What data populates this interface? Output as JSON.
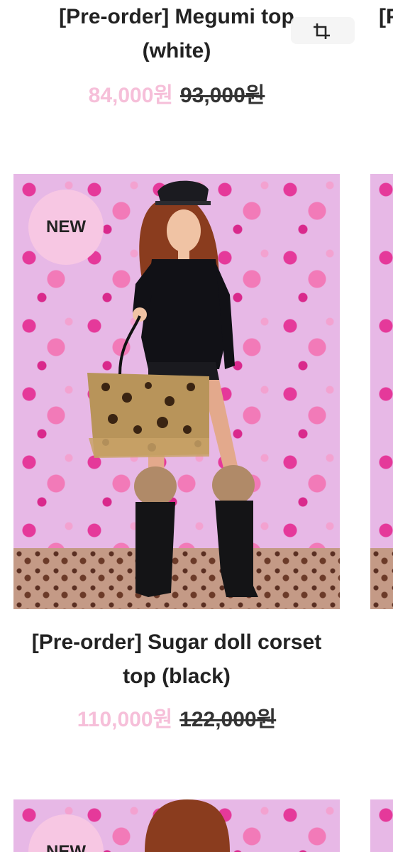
{
  "products": [
    {
      "title_line1": "[Pre-order] Megumi top",
      "title_line2": "(white)",
      "sale_price": "84,000원",
      "original_price": "93,000원"
    },
    {
      "badge": "NEW",
      "title_line1": "[Pre-order] Sugar doll corset",
      "title_line2": "top (black)",
      "sale_price": "110,000원",
      "original_price": "122,000원"
    },
    {
      "badge": "NEW"
    }
  ],
  "next_column": {
    "title_fragment": "[P"
  },
  "overlay": {
    "icon": "crop-icon"
  },
  "colors": {
    "sale_price": "#f6bfd9",
    "badge": "#f7c7e3",
    "wallpaper": "#e7b8e6"
  }
}
